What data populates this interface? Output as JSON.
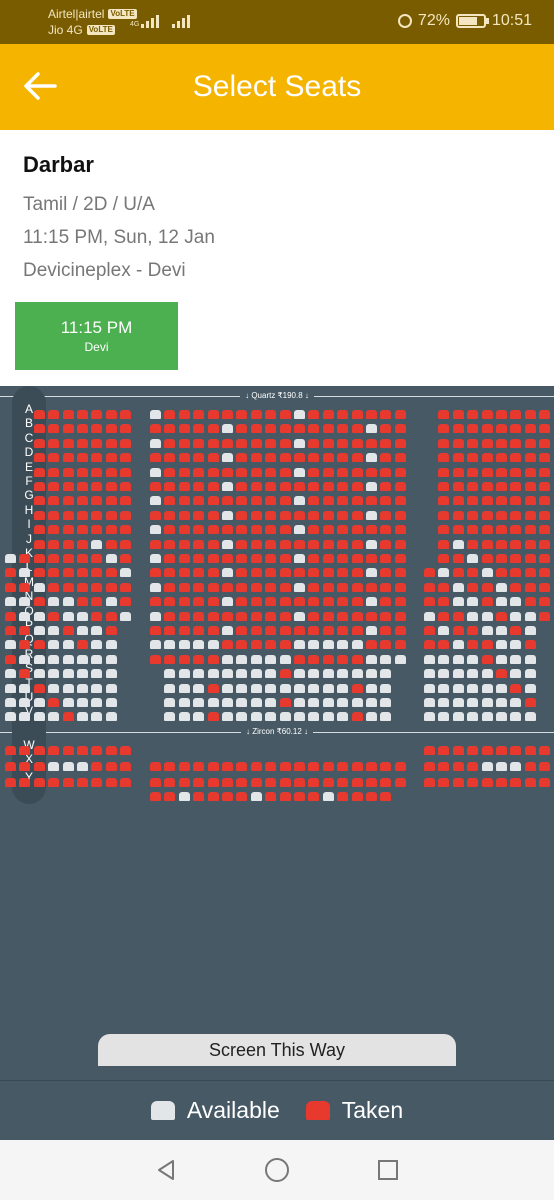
{
  "status_bar": {
    "carrier_line1": "Airtel|airtel",
    "carrier_line2": "Jio 4G",
    "volte_badge": "VoLTE",
    "network_type": "4G",
    "battery_percent": "72%",
    "time": "10:51",
    "text_color": "#f3e6c0"
  },
  "app_bar": {
    "title": "Select Seats",
    "background": "#f4b400",
    "back_icon": "arrow-left-icon"
  },
  "movie": {
    "title": "Darbar",
    "format": "Tamil / 2D / U/A",
    "datetime": "11:15 PM, Sun, 12 Jan",
    "venue": "Devicineplex - Devi"
  },
  "showtime": {
    "time": "11:15 PM",
    "screen": "Devi",
    "color": "#4caf50"
  },
  "seat_map": {
    "background": "#475965",
    "taken_color": "#e8392f",
    "available_color": "#e2e6e8",
    "sections": [
      {
        "label": "↓ Quartz ₹190.8 ↓"
      },
      {
        "label": "↓ Zircon ₹60.12 ↓"
      }
    ],
    "rows": [
      "A",
      "B",
      "C",
      "D",
      "E",
      "F",
      "G",
      "H",
      "I",
      "J",
      "K",
      "L",
      "M",
      "N",
      "O",
      "P",
      "Q",
      "R",
      "S",
      "T",
      "U",
      "V",
      "W",
      "X",
      "Y"
    ],
    "screen_label": "Screen This Way"
  },
  "legend": {
    "available": "Available",
    "taken": "Taken"
  },
  "nav_bar": {
    "back_icon": "triangle-back-icon",
    "home_icon": "circle-home-icon",
    "recents_icon": "square-recents-icon"
  }
}
